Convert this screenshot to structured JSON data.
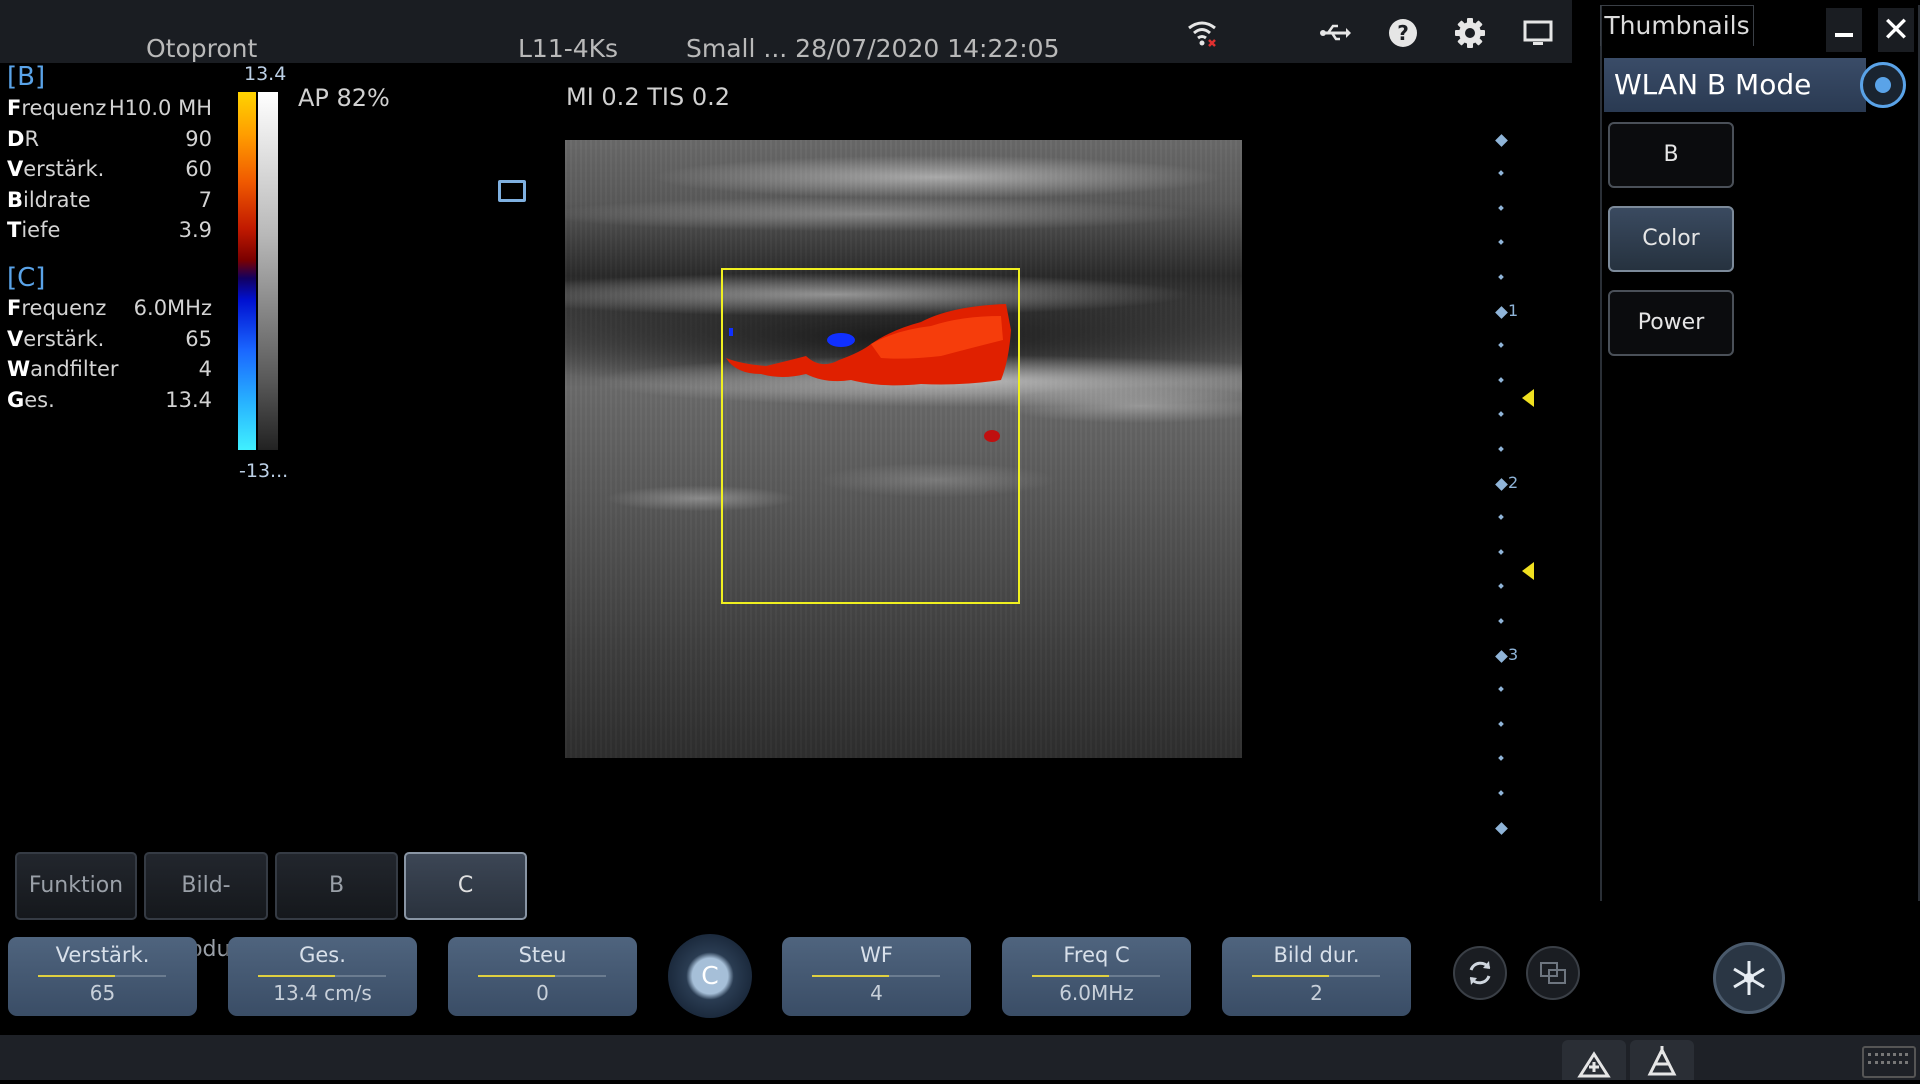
{
  "topbar": {
    "patient": "Otopront",
    "probe": "L11-4Ks",
    "preset_datetime": "Small ... 28/07/2020 14:22:05"
  },
  "b_mode": {
    "header": "[B]",
    "params": [
      {
        "bold": "F",
        "rest": "requenz",
        "value": "H10.0 MH"
      },
      {
        "bold": "D",
        "rest": "R",
        "value": "90"
      },
      {
        "bold": "V",
        "rest": "erstärk.",
        "value": "60"
      },
      {
        "bold": "B",
        "rest": "ildrate",
        "value": "7"
      },
      {
        "bold": "T",
        "rest": "iefe",
        "value": "3.9"
      }
    ]
  },
  "c_mode": {
    "header": "[C]",
    "params": [
      {
        "bold": "F",
        "rest": "requenz",
        "value": "6.0MHz"
      },
      {
        "bold": "V",
        "rest": "erstärk.",
        "value": "65"
      },
      {
        "bold": "W",
        "rest": "andfilter",
        "value": "4"
      },
      {
        "bold": "G",
        "rest": "es.",
        "value": "13.4"
      }
    ]
  },
  "colorbar": {
    "top": "13.4",
    "bottom": "-13..."
  },
  "ap": "AP  82%",
  "mi_tis": "MI 0.2 TIS 0.2",
  "depth_labels": [
    "1",
    "2",
    "3"
  ],
  "right_panel": {
    "tab": "Thumbnails",
    "title": "WLAN B Mode",
    "buttons": [
      "B",
      "Color",
      "Power"
    ],
    "active_button": "Color"
  },
  "tabs": [
    "Funktion",
    "Bild-Modus",
    "B",
    "C"
  ],
  "active_tab": "C",
  "knobs": [
    {
      "label": "Verstärk.",
      "value": "65"
    },
    {
      "label": "Ges.",
      "value": "13.4 cm/s"
    },
    {
      "label": "Steu",
      "value": "0"
    },
    {
      "label": "WF",
      "value": "4"
    },
    {
      "label": "Freq C",
      "value": "6.0MHz"
    },
    {
      "label": "Bild dur.",
      "value": "2"
    }
  ],
  "mode_button": "C",
  "icons": [
    "wifi-icon",
    "usb-icon",
    "help-icon",
    "gear-icon",
    "monitor-icon",
    "minimize-icon",
    "close-icon",
    "target-icon",
    "refresh-icon",
    "dual-view-icon",
    "freeze-icon",
    "measure-icon",
    "annotation-icon",
    "keyboard-icon"
  ],
  "colors": {
    "accent": "#5aa3e8",
    "roi_box": "#f0f020",
    "knob": "#4f647e",
    "flow_red": "#e02000",
    "flow_blue": "#1030ff"
  }
}
